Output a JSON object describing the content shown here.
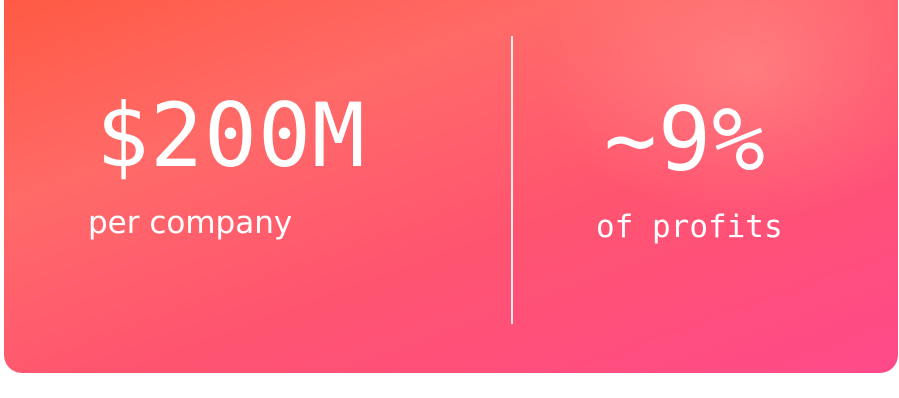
{
  "stats": {
    "left": {
      "value": "$200M",
      "caption": "per company"
    },
    "right": {
      "value": "~9%",
      "caption": "of profits"
    }
  },
  "colors": {
    "gradient_start": "#ff5a44",
    "gradient_mid": "#ff6a68",
    "gradient_end": "#ff4a8a",
    "text": "#ffffff"
  }
}
